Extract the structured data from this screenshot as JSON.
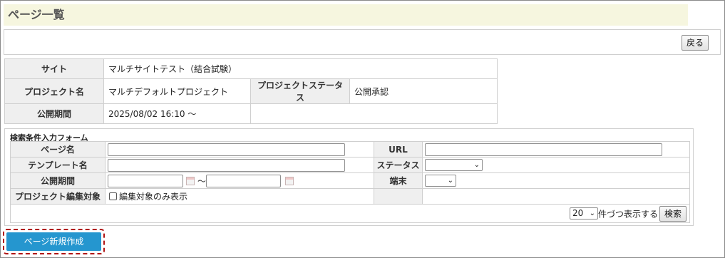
{
  "page": {
    "title": "ページ一覧"
  },
  "toolbar": {
    "back_label": "戻る"
  },
  "info": {
    "site_label": "サイト",
    "site_value": "マルチサイトテスト（結合試験）",
    "project_label": "プロジェクト名",
    "project_value": "マルチデフォルトプロジェクト",
    "status_label": "プロジェクトステータス",
    "status_value": "公開承認",
    "period_label": "公開期間",
    "period_value": "2025/08/02 16:10 ～"
  },
  "search": {
    "form_title": "検索条件入力フォーム",
    "page_name_label": "ページ名",
    "page_name_value": "",
    "url_label": "URL",
    "url_value": "",
    "template_label": "テンプレート名",
    "template_value": "",
    "status_label": "ステータス",
    "status_value": "",
    "period_label": "公開期間",
    "period_from": "",
    "period_sep": "～",
    "period_to": "",
    "device_label": "端末",
    "device_value": "",
    "project_edit_label": "プロジェクト編集対象",
    "edit_only_label": "編集対象のみ表示",
    "per_page_value": "20",
    "per_page_suffix": "件づつ表示する",
    "search_label": "検索"
  },
  "actions": {
    "new_page_label": "ページ新規作成"
  },
  "colors": {
    "accent": "#2596cf",
    "highlight_border": "#b01515",
    "title_bg": "#f6f6df"
  },
  "icons": [
    "calendar-icon",
    "chevron-down-icon",
    "checkbox"
  ]
}
